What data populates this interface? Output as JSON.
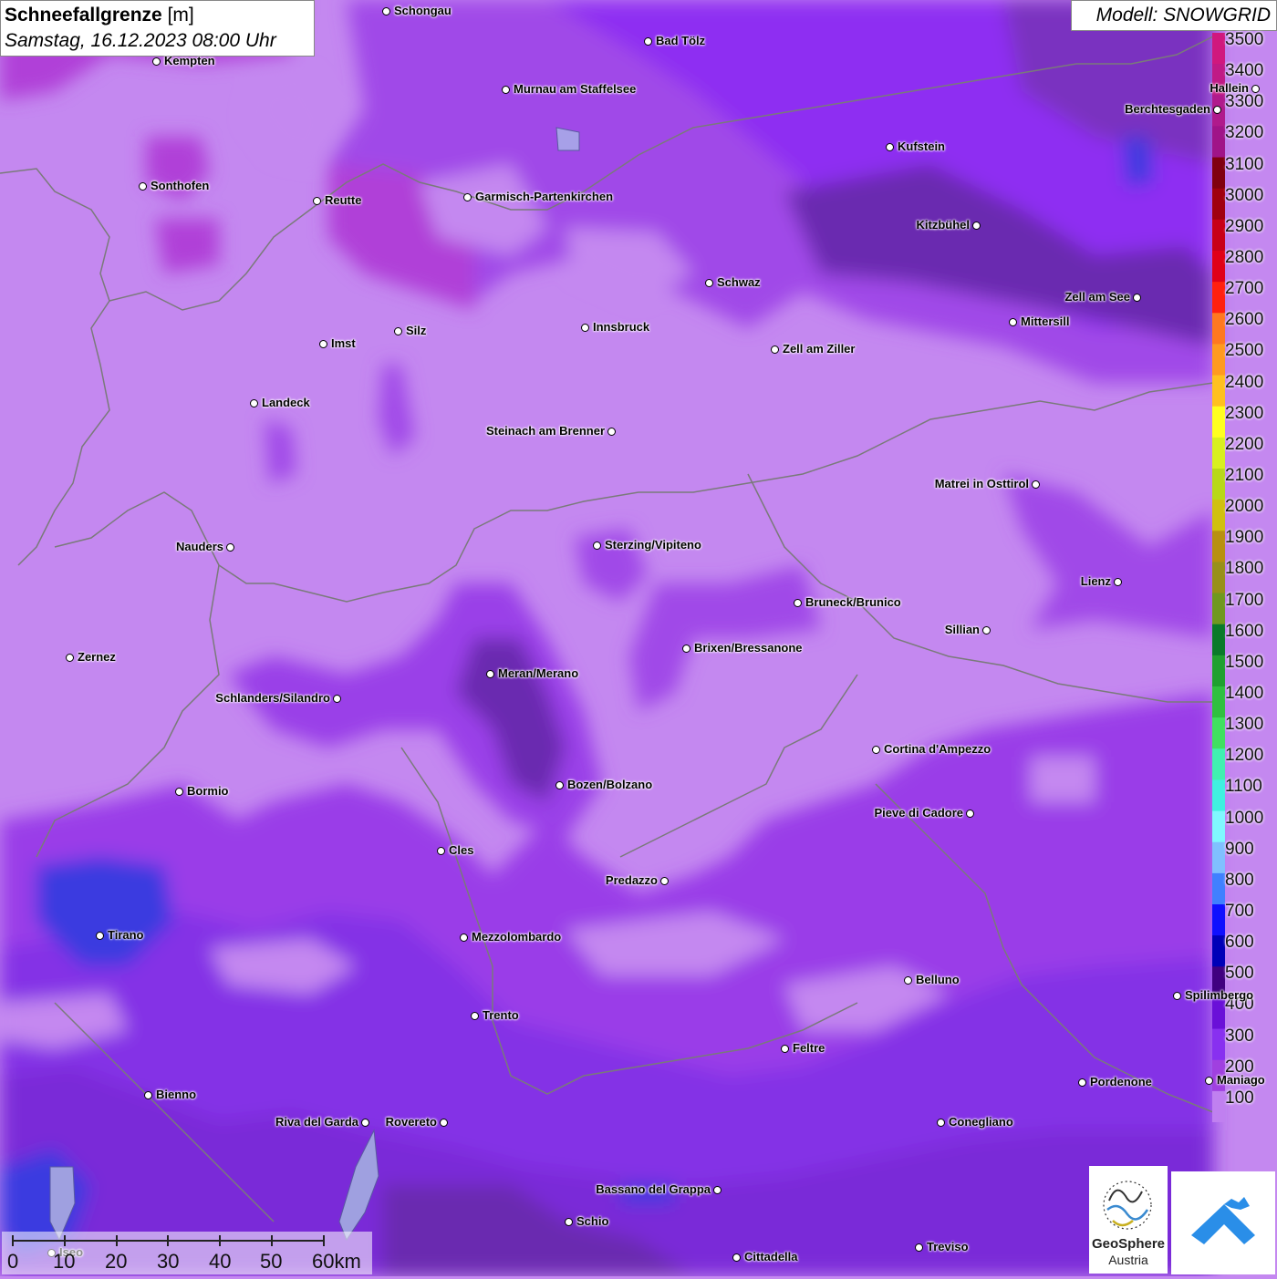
{
  "header": {
    "title": "Schneefallgrenze",
    "unit": "[m]",
    "datetime": "Samstag, 16.12.2023 08:00 Uhr",
    "model": "Modell: SNOWGRID"
  },
  "legend": {
    "labels": [
      "3500",
      "3400",
      "3300",
      "3200",
      "3100",
      "3000",
      "2900",
      "2800",
      "2700",
      "2600",
      "2500",
      "2400",
      "2300",
      "2200",
      "2100",
      "2000",
      "1900",
      "1800",
      "1700",
      "1600",
      "1500",
      "1400",
      "1300",
      "1200",
      "1100",
      "1000",
      "900",
      "800",
      "700",
      "600",
      "500",
      "400",
      "300",
      "200",
      "100"
    ],
    "colors": [
      "#d0187e",
      "#c01a86",
      "#b01a8c",
      "#a01488",
      "#800010",
      "#a00010",
      "#c80018",
      "#e00018",
      "#ff2010",
      "#ff7820",
      "#ff9a20",
      "#ffc020",
      "#ffff20",
      "#d8f020",
      "#b8d818",
      "#d0c010",
      "#b89010",
      "#98901a",
      "#709820",
      "#0a7a2a",
      "#20a030",
      "#30c040",
      "#40e060",
      "#40f0b0",
      "#40f0e0",
      "#80f8ff",
      "#80c0ff",
      "#4080ff",
      "#1010ff",
      "#0000b8",
      "#400080",
      "#6a10d8",
      "#8830f0",
      "#a040e0",
      "#c080f0"
    ]
  },
  "cities": [
    {
      "name": "Schongau"
    },
    {
      "name": "Bad Tölz"
    },
    {
      "name": "Kempten"
    },
    {
      "name": "Murnau am Staffelsee"
    },
    {
      "name": "Hallein"
    },
    {
      "name": "Berchtesgaden"
    },
    {
      "name": "Kufstein"
    },
    {
      "name": "Sonthofen"
    },
    {
      "name": "Reutte"
    },
    {
      "name": "Garmisch-Partenkirchen"
    },
    {
      "name": "Kitzbühel"
    },
    {
      "name": "Schwaz"
    },
    {
      "name": "Zell am See"
    },
    {
      "name": "Mittersill"
    },
    {
      "name": "Innsbruck"
    },
    {
      "name": "Imst"
    },
    {
      "name": "Silz"
    },
    {
      "name": "Zell am Ziller"
    },
    {
      "name": "Landeck"
    },
    {
      "name": "Steinach am Brenner"
    },
    {
      "name": "Matrei in Osttirol"
    },
    {
      "name": "Nauders"
    },
    {
      "name": "Sterzing/Vipiteno"
    },
    {
      "name": "Lienz"
    },
    {
      "name": "Bruneck/Brunico"
    },
    {
      "name": "Sillian"
    },
    {
      "name": "Brixen/Bressanone"
    },
    {
      "name": "Zernez"
    },
    {
      "name": "Meran/Merano"
    },
    {
      "name": "Schlanders/Silandro"
    },
    {
      "name": "Cortina d'Ampezzo"
    },
    {
      "name": "Bozen/Bolzano"
    },
    {
      "name": "Bormio"
    },
    {
      "name": "Pieve di Cadore"
    },
    {
      "name": "Cles"
    },
    {
      "name": "Predazzo"
    },
    {
      "name": "Tirano"
    },
    {
      "name": "Mezzolombardo"
    },
    {
      "name": "Belluno"
    },
    {
      "name": "Spilimbergo"
    },
    {
      "name": "Trento"
    },
    {
      "name": "Feltre"
    },
    {
      "name": "Pordenone"
    },
    {
      "name": "Maniago"
    },
    {
      "name": "Bienno"
    },
    {
      "name": "Riva del Garda"
    },
    {
      "name": "Rovereto"
    },
    {
      "name": "Conegliano"
    },
    {
      "name": "Bassano del Grappa"
    },
    {
      "name": "Schio"
    },
    {
      "name": "Treviso"
    },
    {
      "name": "Cittadella"
    },
    {
      "name": "Iseo"
    }
  ],
  "scale": {
    "labels": [
      "0",
      "10",
      "20",
      "30",
      "40",
      "50",
      "60km"
    ]
  },
  "logos": {
    "geosphere_line1": "GeoSphere",
    "geosphere_line2": "Austria"
  },
  "colors": {
    "bg_light": "#c488f0",
    "mid": "#a34ae8",
    "dark_purple": "#8e2ef2",
    "deep": "#6a2ab0",
    "blue": "#3a3ae0",
    "magenta": "#b040d8"
  }
}
